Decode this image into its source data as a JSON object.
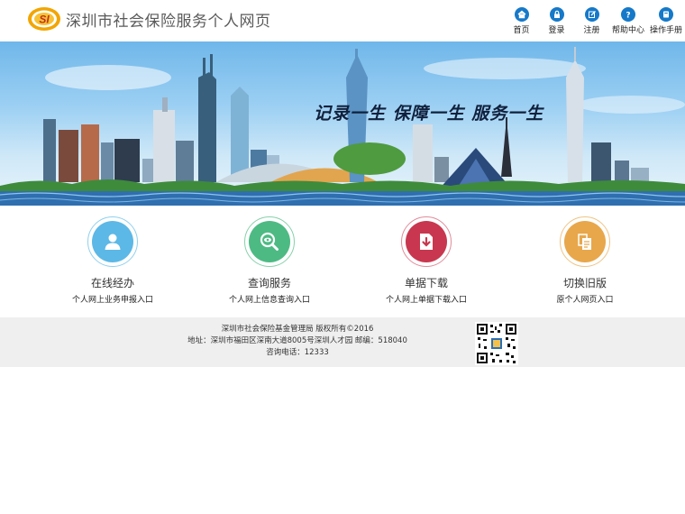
{
  "header": {
    "logo_text": "SI",
    "title": "深圳市社会保险服务个人网页",
    "nav": [
      {
        "label": "首页",
        "icon": "home-icon"
      },
      {
        "label": "登录",
        "icon": "lock-icon"
      },
      {
        "label": "注册",
        "icon": "edit-icon"
      },
      {
        "label": "帮助中心",
        "icon": "help-icon"
      },
      {
        "label": "操作手册",
        "icon": "book-icon"
      }
    ]
  },
  "banner": {
    "slogan": "记录一生  保障一生  服务一生"
  },
  "services": [
    {
      "title": "在线经办",
      "subtitle": "个人网上业务申报入口",
      "icon": "user-icon",
      "color": "#5cb8e6"
    },
    {
      "title": "查询服务",
      "subtitle": "个人网上信息查询入口",
      "icon": "search-eye-icon",
      "color": "#4dba84"
    },
    {
      "title": "单据下载",
      "subtitle": "个人网上单据下载入口",
      "icon": "download-icon",
      "color": "#c8374f"
    },
    {
      "title": "切换旧版",
      "subtitle": "原个人网页入口",
      "icon": "document-switch-icon",
      "color": "#e8a74b"
    }
  ],
  "footer": {
    "line1": "深圳市社会保险基金管理局 版权所有©2016",
    "line2": "地址：深圳市福田区深南大道8005号深圳人才园 邮编：518040",
    "line3": "咨询电话：12333"
  },
  "colors": {
    "nav_icon": "#1679c9",
    "footer_bg": "#efefef"
  }
}
